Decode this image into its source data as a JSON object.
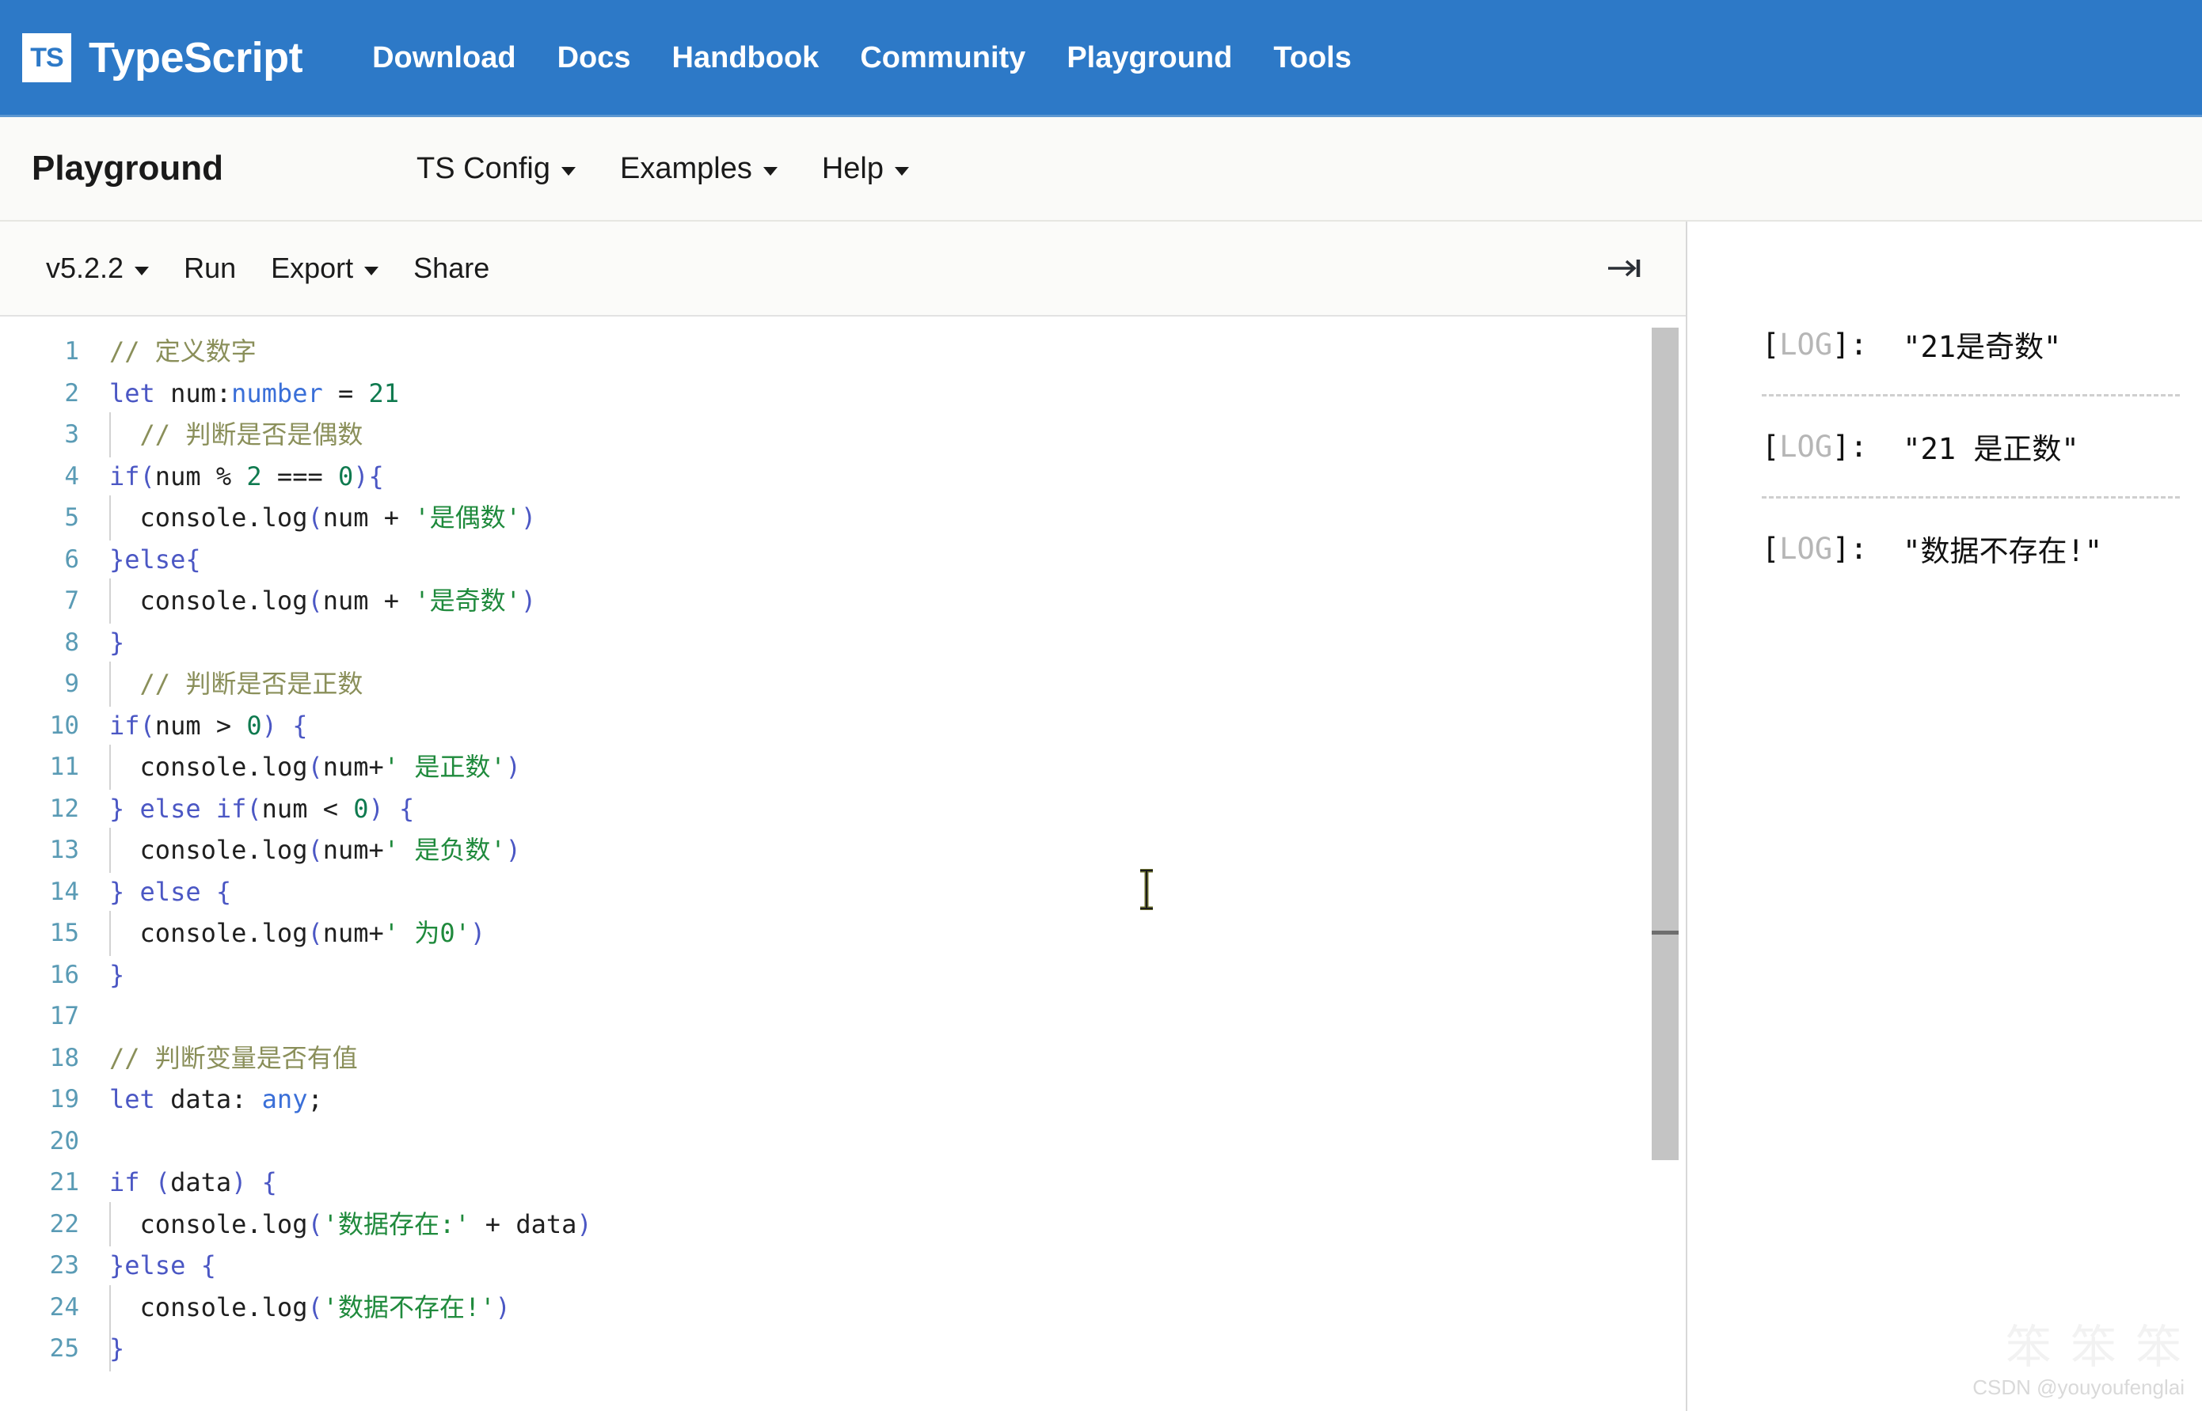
{
  "header": {
    "brand_short": "TS",
    "brand_name": "TypeScript",
    "links": [
      {
        "label": "Download"
      },
      {
        "label": "Docs"
      },
      {
        "label": "Handbook"
      },
      {
        "label": "Community"
      },
      {
        "label": "Playground"
      },
      {
        "label": "Tools"
      }
    ]
  },
  "subnav": {
    "title": "Playground",
    "items": [
      {
        "label": "TS Config",
        "has_caret": true
      },
      {
        "label": "Examples",
        "has_caret": true
      },
      {
        "label": "Help",
        "has_caret": true
      }
    ]
  },
  "toolbar": {
    "version_label": "v5.2.2",
    "run_label": "Run",
    "export_label": "Export",
    "share_label": "Share",
    "collapse_icon": "arrow-to-bar-right-icon"
  },
  "editor": {
    "language": "typescript",
    "first_visible_line": 1,
    "last_visible_line": 25,
    "lines": [
      {
        "n": "1",
        "text": "// 定义数字"
      },
      {
        "n": "2",
        "text": "let num:number = 21"
      },
      {
        "n": "3",
        "text": "  // 判断是否是偶数"
      },
      {
        "n": "4",
        "text": "if(num % 2 === 0){"
      },
      {
        "n": "5",
        "text": "  console.log(num + '是偶数')"
      },
      {
        "n": "6",
        "text": "}else{"
      },
      {
        "n": "7",
        "text": "  console.log(num + '是奇数')"
      },
      {
        "n": "8",
        "text": "}"
      },
      {
        "n": "9",
        "text": "  // 判断是否是正数"
      },
      {
        "n": "10",
        "text": "if(num > 0) {"
      },
      {
        "n": "11",
        "text": "  console.log(num+' 是正数')"
      },
      {
        "n": "12",
        "text": "} else if(num < 0) {"
      },
      {
        "n": "13",
        "text": "  console.log(num+' 是负数')"
      },
      {
        "n": "14",
        "text": "} else {"
      },
      {
        "n": "15",
        "text": "  console.log(num+' 为0')"
      },
      {
        "n": "16",
        "text": "}"
      },
      {
        "n": "17",
        "text": ""
      },
      {
        "n": "18",
        "text": "// 判断变量是否有值"
      },
      {
        "n": "19",
        "text": "let data: any;"
      },
      {
        "n": "20",
        "text": ""
      },
      {
        "n": "21",
        "text": "if (data) {"
      },
      {
        "n": "22",
        "text": "  console.log('数据存在:' + data)"
      },
      {
        "n": "23",
        "text": "}else {"
      },
      {
        "n": "24",
        "text": "  console.log('数据不存在!')"
      },
      {
        "n": "25",
        "text": "}"
      }
    ]
  },
  "console": {
    "entries": [
      {
        "tag": "LOG",
        "value": "\"21是奇数\""
      },
      {
        "tag": "LOG",
        "value": "\"21 是正数\""
      },
      {
        "tag": "LOG",
        "value": "\"数据不存在!\""
      }
    ]
  },
  "watermark": {
    "cn": "笨 笨 笨",
    "text": "CSDN @youyoufenglai"
  },
  "colors": {
    "brand_blue": "#2d79c7",
    "keyword": "#4b57c4",
    "type": "#3a6fd8",
    "string": "#1f8a3c",
    "comment": "#8a8f5a",
    "number": "#0f7a4f",
    "line_number": "#5a9bb5"
  }
}
